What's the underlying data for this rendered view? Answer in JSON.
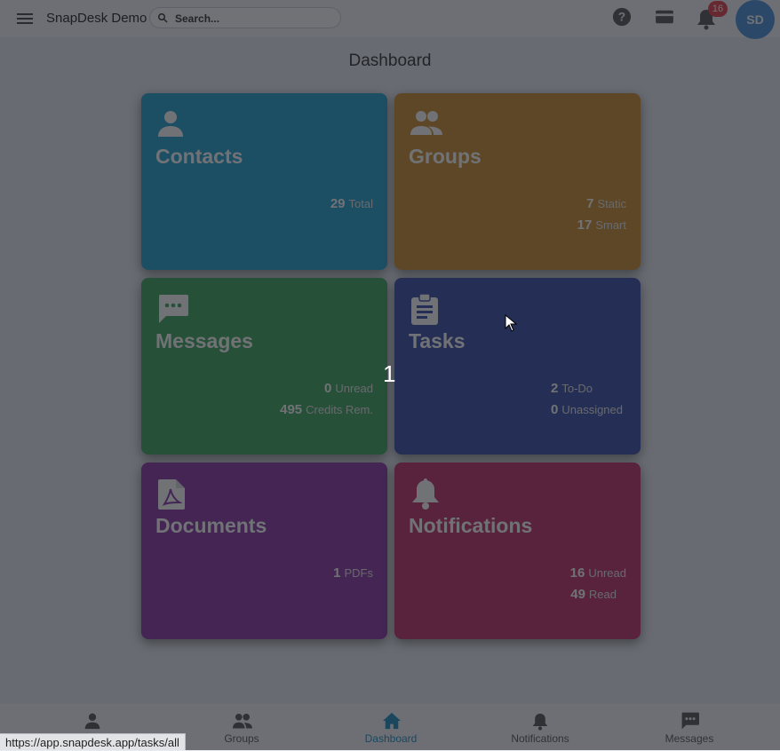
{
  "app_bar": {
    "title": "SnapDesk Demo",
    "search_placeholder": "Search...",
    "notification_count": "16",
    "avatar_initials": "SD",
    "icons": [
      "menu-icon",
      "search-icon",
      "help-icon",
      "credit-card-icon",
      "bell-icon"
    ]
  },
  "page": {
    "title": "Dashboard"
  },
  "cards": {
    "contacts": {
      "title": "Contacts",
      "icon": "person-icon",
      "color": "#23a3cf",
      "stats": [
        {
          "value": "29",
          "label": "Total"
        }
      ]
    },
    "groups": {
      "title": "Groups",
      "icon": "people-icon",
      "color": "#cf8f2f",
      "stats": [
        {
          "value": "7",
          "label": "Static"
        },
        {
          "value": "17",
          "label": "Smart"
        }
      ]
    },
    "messages": {
      "title": "Messages",
      "icon": "chat-icon",
      "color": "#3fa75e",
      "stats": [
        {
          "value": "0",
          "label": "Unread"
        },
        {
          "value": "495",
          "label": "Credits Rem."
        }
      ]
    },
    "tasks": {
      "title": "Tasks",
      "icon": "clipboard-icon",
      "color": "#3b4fa8",
      "stats": [
        {
          "value": "2",
          "label": "To-Do"
        },
        {
          "value": "0",
          "label": "Unassigned"
        }
      ]
    },
    "documents": {
      "title": "Documents",
      "icon": "pdf-icon",
      "color": "#8b35a6",
      "stats": [
        {
          "value": "1",
          "label": "PDFs"
        }
      ]
    },
    "notifications": {
      "title": "Notifications",
      "icon": "bell-icon",
      "color": "#c23169",
      "stats": [
        {
          "value": "16",
          "label": "Unread"
        },
        {
          "value": "49",
          "label": "Read"
        }
      ]
    }
  },
  "overlay_counter": "1",
  "bottom_nav": {
    "items": [
      {
        "label": "",
        "icon": "person-icon"
      },
      {
        "label": "Groups",
        "icon": "people-icon"
      },
      {
        "label": "Dashboard",
        "icon": "home-icon",
        "active": true
      },
      {
        "label": "Notifications",
        "icon": "bell-icon"
      },
      {
        "label": "Messages",
        "icon": "chat-icon"
      }
    ]
  },
  "status_bar_url": "https://app.snapdesk.app/tasks/all",
  "colors": {
    "active_nav": "#1f8fbf",
    "badge": "#e8414a",
    "avatar": "#4a90d9"
  }
}
